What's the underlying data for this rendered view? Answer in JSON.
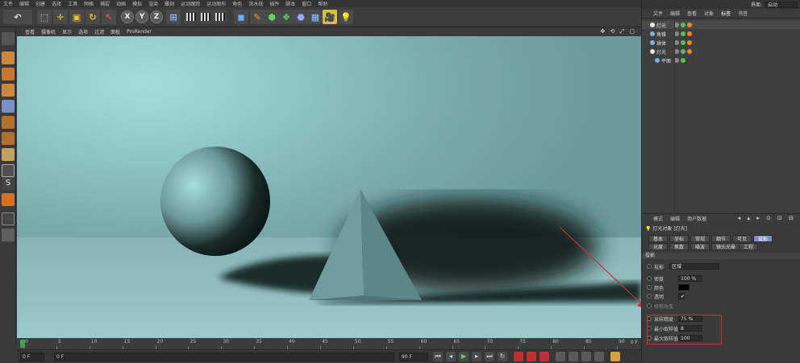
{
  "menu": [
    "文件",
    "编辑",
    "创建",
    "选择",
    "工具",
    "网格",
    "捕捉",
    "动画",
    "模拟",
    "渲染",
    "雕刻",
    "运动跟踪",
    "运动图形",
    "角色",
    "流水线",
    "插件",
    "脚本",
    "窗口",
    "帮助"
  ],
  "viewport": {
    "menu": [
      "查看",
      "摄像机",
      "显示",
      "选项",
      "过滤",
      "面板",
      "ProRender"
    ],
    "nav_icons": "✥ ⟲ ⤢ ▢"
  },
  "timeline": {
    "ticks": [
      "0",
      "5",
      "10",
      "15",
      "20",
      "25",
      "30",
      "35",
      "40",
      "45",
      "50",
      "55",
      "60",
      "65",
      "70",
      "75",
      "80",
      "85",
      "90"
    ],
    "end_label": "0 F"
  },
  "playback": {
    "start_frame": "0 F",
    "range_start": "0 F",
    "range_end": "90 F",
    "end_frame": "90 F",
    "buttons": [
      "⏮",
      "◂",
      "▶",
      "▸",
      "⏭",
      "↻"
    ]
  },
  "right_panel": {
    "layout_label": "界面:",
    "layout_value": "启动",
    "object_menu": [
      "文件",
      "编辑",
      "查看",
      "对象",
      "标签",
      "书签"
    ],
    "object_menu_active": "标签",
    "objects": [
      {
        "name": "灯光",
        "color": "#e6e6e6",
        "indent": 0,
        "selected": true
      },
      {
        "name": "角锥",
        "color": "#7bb0e0",
        "indent": 0,
        "selected": false
      },
      {
        "name": "球体",
        "color": "#7bb0e0",
        "indent": 0,
        "selected": false
      },
      {
        "name": "灯光",
        "color": "#e6e6e6",
        "indent": 0,
        "selected": false
      },
      {
        "name": "平面",
        "color": "#7bb0e0",
        "indent": 1,
        "selected": false
      }
    ],
    "attr_menu": [
      "模式",
      "编辑",
      "用户数据"
    ],
    "attr_arrows": "◂ ▴ ▸ ⊙ ⊡ ⊟",
    "attr_title": "灯光对象 [灯光]",
    "tabs_row1": [
      "基本",
      "坐标",
      "常规",
      "细节",
      "可见",
      "投影"
    ],
    "tabs_row2": [
      "光度",
      "焦散",
      "噪波",
      "镜头光晕",
      "工程"
    ],
    "active_tab": "投影",
    "section": "投影",
    "shadow_type": {
      "label": "投影",
      "value": "区域"
    },
    "props": [
      {
        "label": "密度",
        "value": "100 %",
        "dim": false
      },
      {
        "label": "颜色",
        "value": "",
        "dim": false,
        "swatch": "#000000"
      },
      {
        "label": "透明",
        "value": "✔",
        "dim": false
      },
      {
        "label": "修剪改变",
        "value": "",
        "dim": true
      },
      {
        "label": "采样精度",
        "value": "75 %",
        "dim": false
      },
      {
        "label": "最小取样值",
        "value": "8",
        "dim": false
      },
      {
        "label": "最大取样值",
        "value": "100",
        "dim": false
      }
    ]
  },
  "colors": {
    "accent_tab": "#7a8fc7",
    "annotation_red": "#d23030",
    "timeline_marker": "#3ea83e"
  }
}
